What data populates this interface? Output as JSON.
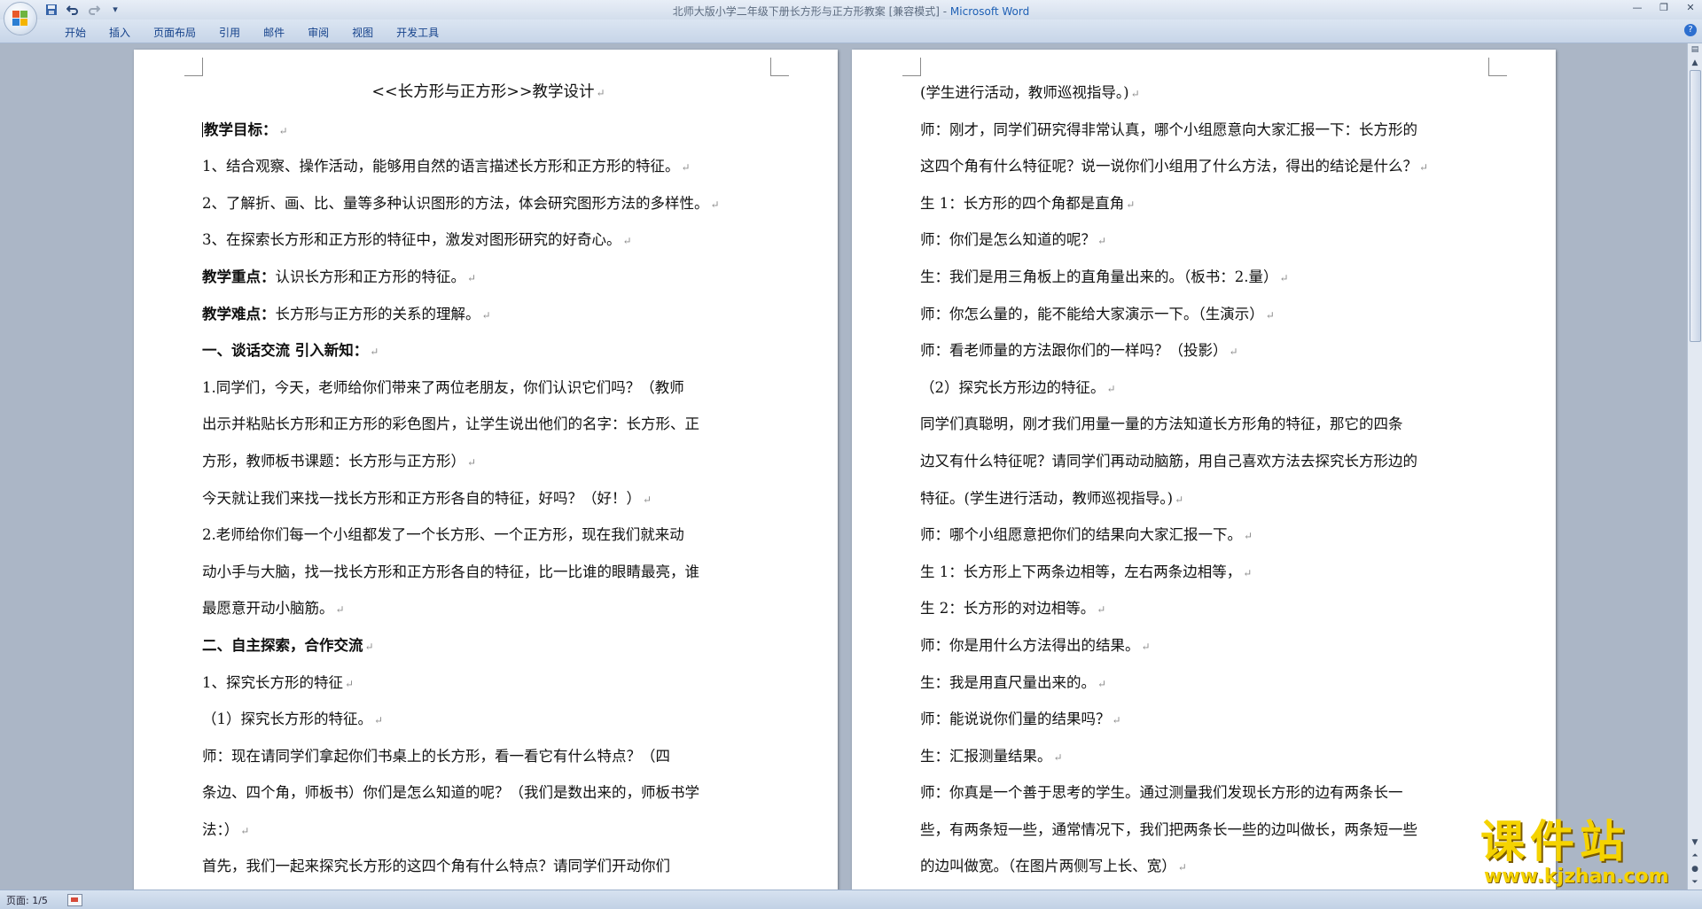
{
  "window": {
    "title_doc": "北师大版小学二年级下册长方形与正方形教案 [兼容模式] - ",
    "title_app": "Microsoft Word"
  },
  "quick_access": {
    "save": "save-icon",
    "undo": "undo-icon",
    "redo": "redo-icon",
    "customize": "▾"
  },
  "ribbon": {
    "tabs": [
      "开始",
      "插入",
      "页面布局",
      "引用",
      "邮件",
      "审阅",
      "视图",
      "开发工具"
    ]
  },
  "status": {
    "page_info": "页面: 1/5"
  },
  "watermark": {
    "brand": "课件站",
    "url": "www.kjzhan.com"
  },
  "pilcrow": "↵",
  "document": {
    "left_page": [
      {
        "text": "<<长方形与正方形>>教学设计",
        "style": "title"
      },
      {
        "text": "教学目标：",
        "style": "bold",
        "cursor": true
      },
      {
        "text": " 1、结合观察、操作活动，能够用自然的语言描述长方形和正方形的特征。"
      },
      {
        "text": " 2、了解折、画、比、量等多种认识图形的方法，体会研究图形方法的多样性。"
      },
      {
        "text": " 3、在探索长方形和正方形的特征中，激发对图形研究的好奇心。"
      },
      {
        "label": "教学重点：",
        "text": "认识长方形和正方形的特征。"
      },
      {
        "label": "教学难点：",
        "text": "长方形与正方形的关系的理解。"
      },
      {
        "text": "一、谈话交流   引入新知：",
        "style": "bold"
      },
      {
        "text": "    1.同学们，今天，老师给你们带来了两位老朋友，你们认识它们吗？（教师",
        "nopm": true
      },
      {
        "text": "出示并粘贴长方形和正方形的彩色图片，让学生说出他们的名字：长方形、正",
        "nopm": true
      },
      {
        "text": "方形，教师板书课题：长方形与正方形）"
      },
      {
        "text": "今天就让我们来找一找长方形和正方形各自的特征，好吗？（好！）"
      },
      {
        "text": "    2.老师给你们每一个小组都发了一个长方形、一个正方形，现在我们就来动",
        "nopm": true
      },
      {
        "text": "动小手与大脑，找一找长方形和正方形各自的特征，比一比谁的眼睛最亮，谁",
        "nopm": true
      },
      {
        "text": "最愿意开动小脑筋。"
      },
      {
        "text": "二、自主探索，合作交流",
        "style": "bold"
      },
      {
        "text": " 1、探究长方形的特征"
      },
      {
        "text": "（1）探究长方形的特征。"
      },
      {
        "text": "    师：现在请同学们拿起你们书桌上的长方形，看一看它有什么特点？（四",
        "nopm": true
      },
      {
        "text": "条边、四个角，师板书）你们是怎么知道的呢？（我们是数出来的，师板书学",
        "nopm": true
      },
      {
        "text": "法：）"
      },
      {
        "text": "    首先，我们一起来探究长方形的这四个角有什么特点？请同学们开动你们",
        "nopm": true
      }
    ],
    "right_page": [
      {
        "text": "  (学生进行活动，教师巡视指导。)"
      },
      {
        "text": "师：刚才，同学们研究得非常认真，哪个小组愿意向大家汇报一下：长方形的",
        "nopm": true
      },
      {
        "text": "这四个角有什么特征呢？说一说你们小组用了什么方法，得出的结论是什么？"
      },
      {
        "text": "生 1：长方形的四个角都是直角"
      },
      {
        "text": "师：你们是怎么知道的呢？"
      },
      {
        "text": "生：我们是用三角板上的直角量出来的。（板书：2.量）"
      },
      {
        "text": "师：你怎么量的，能不能给大家演示一下。（生演示）"
      },
      {
        "text": "师：看老师量的方法跟你们的一样吗？（投影）"
      },
      {
        "text": "  （2）探究长方形边的特征。"
      },
      {
        "text": "    同学们真聪明，刚才我们用量一量的方法知道长方形角的特征，那它的四条",
        "nopm": true
      },
      {
        "text": "边又有什么特征呢？请同学们再动动脑筋，用自己喜欢方法去探究长方形边的",
        "nopm": true
      },
      {
        "text": "特征。(学生进行活动，教师巡视指导。)"
      },
      {
        "text": "    师：哪个小组愿意把你们的结果向大家汇报一下。"
      },
      {
        "text": "    生 1：长方形上下两条边相等，左右两条边相等，"
      },
      {
        "text": "    生 2：长方形的对边相等。"
      },
      {
        "text": "    师：你是用什么方法得出的结果。"
      },
      {
        "text": "    生：我是用直尺量出来的。"
      },
      {
        "text": "    师：能说说你们量的结果吗？"
      },
      {
        "text": "    生：汇报测量结果。"
      },
      {
        "text": "    师：你真是一个善于思考的学生。通过测量我们发现长方形的边有两条长一",
        "nopm": true
      },
      {
        "text": "些，有两条短一些，通常情况下，我们把两条长一些的边叫做长，两条短一些",
        "nopm": true
      },
      {
        "text": "的边叫做宽。（在图片两侧写上长、宽）"
      }
    ]
  }
}
